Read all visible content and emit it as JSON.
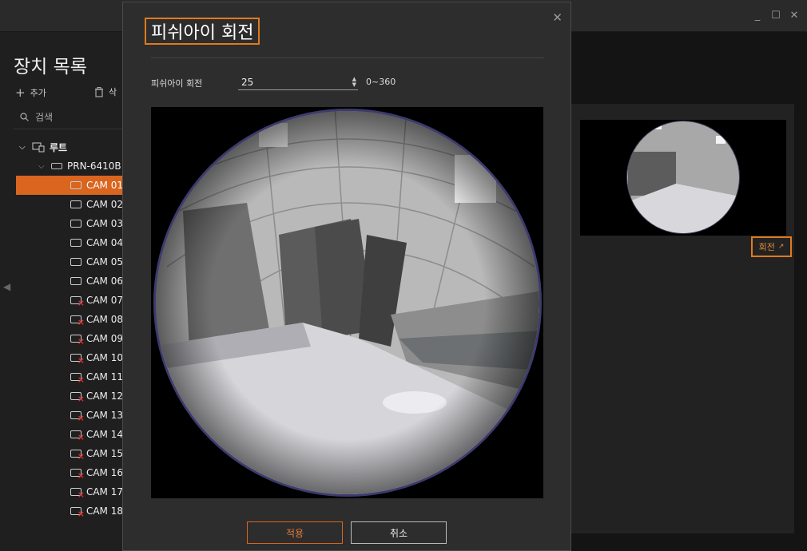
{
  "window": {
    "minimize": "_",
    "maximize": "☐",
    "close": "✕"
  },
  "sidebar": {
    "title": "장치 목록",
    "add_label": "추가",
    "delete_label": "삭",
    "search_placeholder": "검색",
    "root_label": "루트",
    "device_label": "PRN-6410B",
    "cameras": [
      {
        "label": "CAM 01",
        "status": "connected",
        "selected": true
      },
      {
        "label": "CAM 02",
        "status": "connected"
      },
      {
        "label": "CAM 03",
        "status": "connected"
      },
      {
        "label": "CAM 04",
        "status": "connected"
      },
      {
        "label": "CAM 05",
        "status": "connected"
      },
      {
        "label": "CAM 06",
        "status": "connected"
      },
      {
        "label": "CAM 07",
        "status": "disconnected"
      },
      {
        "label": "CAM 08",
        "status": "disconnected"
      },
      {
        "label": "CAM 09",
        "status": "disconnected"
      },
      {
        "label": "CAM 10",
        "status": "disconnected"
      },
      {
        "label": "CAM 11",
        "status": "disconnected"
      },
      {
        "label": "CAM 12",
        "status": "disconnected"
      },
      {
        "label": "CAM 13",
        "status": "disconnected"
      },
      {
        "label": "CAM 14",
        "status": "disconnected"
      },
      {
        "label": "CAM 15",
        "status": "disconnected"
      },
      {
        "label": "CAM 16",
        "status": "disconnected"
      },
      {
        "label": "CAM 17",
        "status": "disconnected"
      },
      {
        "label": "CAM 18",
        "status": "disconnected"
      }
    ]
  },
  "preview": {
    "rotate_label": "회전",
    "rotate_icon": "↗"
  },
  "modal": {
    "title": "피쉬아이 회전",
    "rotation_label": "피쉬아이 회전",
    "rotation_value": "25",
    "rotation_range": "0~360",
    "apply_label": "적용",
    "cancel_label": "취소"
  },
  "colors": {
    "accent": "#e07a1e",
    "selected": "#d9651e",
    "offline": "#e03030"
  }
}
